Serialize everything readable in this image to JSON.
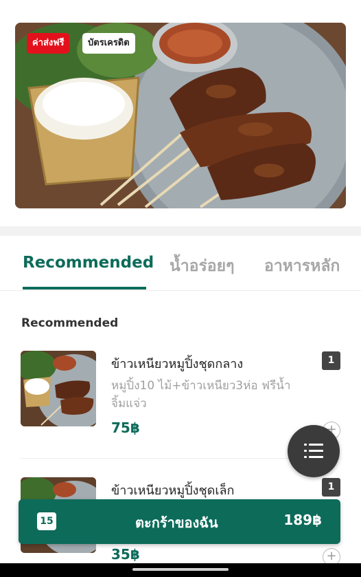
{
  "hero": {
    "badges": {
      "free_delivery": "ค่าส่งฟรี",
      "credit_card": "บัตรเครดิต"
    }
  },
  "tabs": [
    {
      "label": "Recommended",
      "active": true
    },
    {
      "label": "น้ำอร่อยๆ",
      "active": false
    },
    {
      "label": "อาหารหลัก",
      "active": false
    }
  ],
  "section": {
    "title": "Recommended"
  },
  "items": [
    {
      "name": "ข้าวเหนียวหมูปิ้งชุดกลาง",
      "description": "หมูปิ้ง10 ไม้+ข้าวเหนียว3ห่อ ฟรีน้ำจิ้มแจ่ว",
      "price": "75฿",
      "quantity": "1",
      "add_symbol": "+"
    },
    {
      "name": "ข้าวเหนียวหมูปิ้งชุดเล็ก",
      "description": "",
      "price": "35฿",
      "quantity": "1",
      "add_symbol": "+"
    }
  ],
  "cart": {
    "count": "15",
    "label": "ตะกร้าของฉัน",
    "total": "189฿"
  },
  "icons": {
    "fab": "menu-list-icon",
    "add": "plus-circle-icon"
  },
  "colors": {
    "accent": "#0d6b5a",
    "badge_red": "#e3111b",
    "fab": "#3b3b3b"
  }
}
